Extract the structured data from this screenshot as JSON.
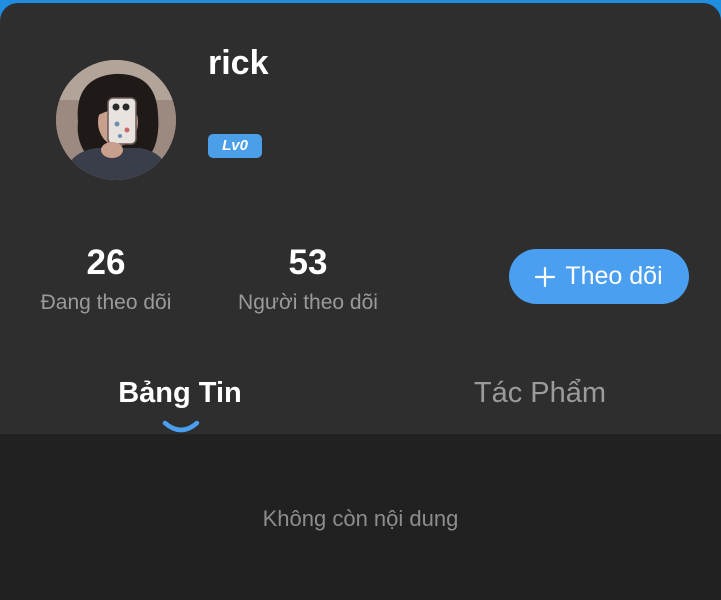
{
  "profile": {
    "username": "rick",
    "level_badge": "Lv0",
    "avatar_icon": "user-avatar-photo"
  },
  "stats": {
    "following": {
      "count": "26",
      "label": "Đang theo dõi"
    },
    "followers": {
      "count": "53",
      "label": "Người theo dõi"
    }
  },
  "follow_button": {
    "label": "Theo dõi",
    "icon": "plus-icon"
  },
  "tabs": [
    {
      "label": "Bảng Tin",
      "active": true
    },
    {
      "label": "Tác Phẩm",
      "active": false
    }
  ],
  "content": {
    "empty_message": "Không còn nội dung"
  },
  "colors": {
    "background": "#2e2e2e",
    "content_background": "#212121",
    "accent": "#4a9ff0",
    "top_bar": "#1f8de0",
    "text_primary": "#ffffff",
    "text_secondary": "#9a9a9a"
  }
}
